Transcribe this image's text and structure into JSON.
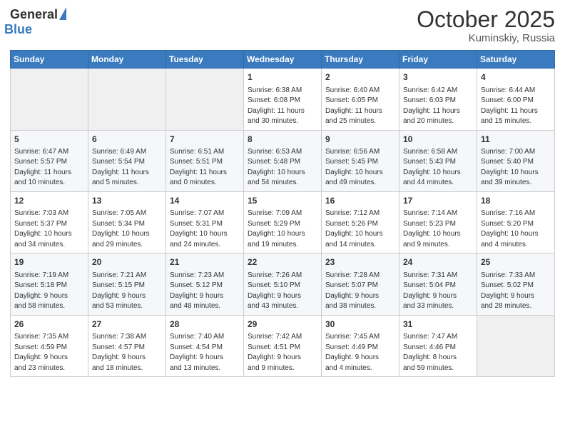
{
  "header": {
    "logo_general": "General",
    "logo_blue": "Blue",
    "month": "October 2025",
    "location": "Kuminskiy, Russia"
  },
  "weekdays": [
    "Sunday",
    "Monday",
    "Tuesday",
    "Wednesday",
    "Thursday",
    "Friday",
    "Saturday"
  ],
  "weeks": [
    [
      {
        "day": "",
        "info": ""
      },
      {
        "day": "",
        "info": ""
      },
      {
        "day": "",
        "info": ""
      },
      {
        "day": "1",
        "info": "Sunrise: 6:38 AM\nSunset: 6:08 PM\nDaylight: 11 hours\nand 30 minutes."
      },
      {
        "day": "2",
        "info": "Sunrise: 6:40 AM\nSunset: 6:05 PM\nDaylight: 11 hours\nand 25 minutes."
      },
      {
        "day": "3",
        "info": "Sunrise: 6:42 AM\nSunset: 6:03 PM\nDaylight: 11 hours\nand 20 minutes."
      },
      {
        "day": "4",
        "info": "Sunrise: 6:44 AM\nSunset: 6:00 PM\nDaylight: 11 hours\nand 15 minutes."
      }
    ],
    [
      {
        "day": "5",
        "info": "Sunrise: 6:47 AM\nSunset: 5:57 PM\nDaylight: 11 hours\nand 10 minutes."
      },
      {
        "day": "6",
        "info": "Sunrise: 6:49 AM\nSunset: 5:54 PM\nDaylight: 11 hours\nand 5 minutes."
      },
      {
        "day": "7",
        "info": "Sunrise: 6:51 AM\nSunset: 5:51 PM\nDaylight: 11 hours\nand 0 minutes."
      },
      {
        "day": "8",
        "info": "Sunrise: 6:53 AM\nSunset: 5:48 PM\nDaylight: 10 hours\nand 54 minutes."
      },
      {
        "day": "9",
        "info": "Sunrise: 6:56 AM\nSunset: 5:45 PM\nDaylight: 10 hours\nand 49 minutes."
      },
      {
        "day": "10",
        "info": "Sunrise: 6:58 AM\nSunset: 5:43 PM\nDaylight: 10 hours\nand 44 minutes."
      },
      {
        "day": "11",
        "info": "Sunrise: 7:00 AM\nSunset: 5:40 PM\nDaylight: 10 hours\nand 39 minutes."
      }
    ],
    [
      {
        "day": "12",
        "info": "Sunrise: 7:03 AM\nSunset: 5:37 PM\nDaylight: 10 hours\nand 34 minutes."
      },
      {
        "day": "13",
        "info": "Sunrise: 7:05 AM\nSunset: 5:34 PM\nDaylight: 10 hours\nand 29 minutes."
      },
      {
        "day": "14",
        "info": "Sunrise: 7:07 AM\nSunset: 5:31 PM\nDaylight: 10 hours\nand 24 minutes."
      },
      {
        "day": "15",
        "info": "Sunrise: 7:09 AM\nSunset: 5:29 PM\nDaylight: 10 hours\nand 19 minutes."
      },
      {
        "day": "16",
        "info": "Sunrise: 7:12 AM\nSunset: 5:26 PM\nDaylight: 10 hours\nand 14 minutes."
      },
      {
        "day": "17",
        "info": "Sunrise: 7:14 AM\nSunset: 5:23 PM\nDaylight: 10 hours\nand 9 minutes."
      },
      {
        "day": "18",
        "info": "Sunrise: 7:16 AM\nSunset: 5:20 PM\nDaylight: 10 hours\nand 4 minutes."
      }
    ],
    [
      {
        "day": "19",
        "info": "Sunrise: 7:19 AM\nSunset: 5:18 PM\nDaylight: 9 hours\nand 58 minutes."
      },
      {
        "day": "20",
        "info": "Sunrise: 7:21 AM\nSunset: 5:15 PM\nDaylight: 9 hours\nand 53 minutes."
      },
      {
        "day": "21",
        "info": "Sunrise: 7:23 AM\nSunset: 5:12 PM\nDaylight: 9 hours\nand 48 minutes."
      },
      {
        "day": "22",
        "info": "Sunrise: 7:26 AM\nSunset: 5:10 PM\nDaylight: 9 hours\nand 43 minutes."
      },
      {
        "day": "23",
        "info": "Sunrise: 7:28 AM\nSunset: 5:07 PM\nDaylight: 9 hours\nand 38 minutes."
      },
      {
        "day": "24",
        "info": "Sunrise: 7:31 AM\nSunset: 5:04 PM\nDaylight: 9 hours\nand 33 minutes."
      },
      {
        "day": "25",
        "info": "Sunrise: 7:33 AM\nSunset: 5:02 PM\nDaylight: 9 hours\nand 28 minutes."
      }
    ],
    [
      {
        "day": "26",
        "info": "Sunrise: 7:35 AM\nSunset: 4:59 PM\nDaylight: 9 hours\nand 23 minutes."
      },
      {
        "day": "27",
        "info": "Sunrise: 7:38 AM\nSunset: 4:57 PM\nDaylight: 9 hours\nand 18 minutes."
      },
      {
        "day": "28",
        "info": "Sunrise: 7:40 AM\nSunset: 4:54 PM\nDaylight: 9 hours\nand 13 minutes."
      },
      {
        "day": "29",
        "info": "Sunrise: 7:42 AM\nSunset: 4:51 PM\nDaylight: 9 hours\nand 9 minutes."
      },
      {
        "day": "30",
        "info": "Sunrise: 7:45 AM\nSunset: 4:49 PM\nDaylight: 9 hours\nand 4 minutes."
      },
      {
        "day": "31",
        "info": "Sunrise: 7:47 AM\nSunset: 4:46 PM\nDaylight: 8 hours\nand 59 minutes."
      },
      {
        "day": "",
        "info": ""
      }
    ]
  ]
}
